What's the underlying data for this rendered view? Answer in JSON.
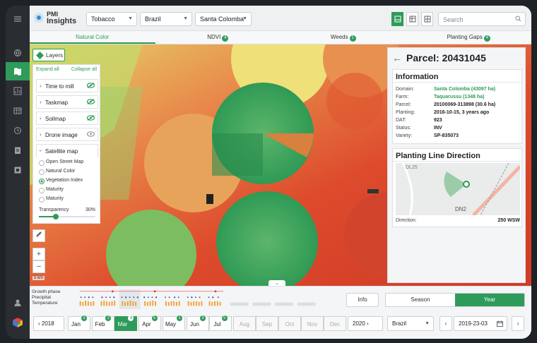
{
  "app": {
    "logo_line1": "PMI",
    "logo_line2": "Insights"
  },
  "filters": {
    "crop": "Tobacco",
    "country": "Brazil",
    "domain": "Santa Colomba"
  },
  "search": {
    "placeholder": "Search"
  },
  "tabs": [
    {
      "label": "Natural Color",
      "badge": ""
    },
    {
      "label": "NDVI",
      "badge": "4"
    },
    {
      "label": "Weeds",
      "badge": "1"
    },
    {
      "label": "Planting Gaps",
      "badge": "4"
    }
  ],
  "layers": {
    "button_label": "Layers",
    "expand_all": "Expand all",
    "collapse_all": "Collapse all",
    "items": [
      "Time to mill",
      "Taskmap",
      "Soilmap",
      "Drone image"
    ],
    "satellite_label": "Satellite map",
    "satellite_options": [
      "Open Street Map",
      "Natural Color",
      "Vegetation Index",
      "Maturity",
      "Maturity"
    ],
    "selected_option": "Vegetation Index",
    "transparency_label": "Transparency",
    "transparency_value": "30%",
    "transparency_fraction": 0.3,
    "scale_label": "5 km"
  },
  "parcel": {
    "title": "Parcel: 20431045",
    "info_heading": "Information",
    "info": [
      {
        "k": "Domain:",
        "v": "Santa Colomba (43097 ha)",
        "link": true
      },
      {
        "k": "Farm:",
        "v": "Taquarussu (1348 ha)",
        "link": true
      },
      {
        "k": "Parcel:",
        "v": "20100069-313898 (30.6 ha)",
        "link": false
      },
      {
        "k": "Planting:",
        "v": "2016-10-15, 3 years ago",
        "link": false
      },
      {
        "k": "DAT:",
        "v": "923",
        "link": false
      },
      {
        "k": "Status:",
        "v": "INV",
        "link": false
      },
      {
        "k": "Variety:",
        "v": "SP-835073",
        "link": false
      }
    ],
    "planting_heading": "Planting Line Direction",
    "map_labels": [
      "DL25",
      "DN2"
    ],
    "direction_label": "Direction:",
    "direction_value": "250 WSW"
  },
  "timeline": {
    "labels": [
      "Growth phase",
      "Precipitat",
      "Temperature"
    ],
    "info_button": "Info",
    "season": "Season",
    "year": "Year",
    "year_selected": "2018",
    "months": [
      {
        "label": "Jan",
        "badge": "3",
        "state": "normal"
      },
      {
        "label": "Feb",
        "badge": "2",
        "state": "normal"
      },
      {
        "label": "Mar",
        "badge": "4",
        "state": "on"
      },
      {
        "label": "Apr",
        "badge": "5",
        "state": "normal"
      },
      {
        "label": "May",
        "badge": "1",
        "state": "normal"
      },
      {
        "label": "Jun",
        "badge": "3",
        "state": "normal"
      },
      {
        "label": "Jul",
        "badge": "5",
        "state": "normal"
      },
      {
        "label": "Aug",
        "badge": "",
        "state": "dim"
      },
      {
        "label": "Sep",
        "badge": "",
        "state": "dim"
      },
      {
        "label": "Oct",
        "badge": "",
        "state": "dim"
      },
      {
        "label": "Nov",
        "badge": "",
        "state": "dim"
      },
      {
        "label": "Dec",
        "badge": "",
        "state": "dim"
      }
    ],
    "year_right": "2020",
    "country": "Brazil",
    "date": "2019-23-03"
  },
  "colors": {
    "accent": "#2e9b5a",
    "ndvi_low": "#d9432a",
    "ndvi_high": "#2f9a55"
  }
}
